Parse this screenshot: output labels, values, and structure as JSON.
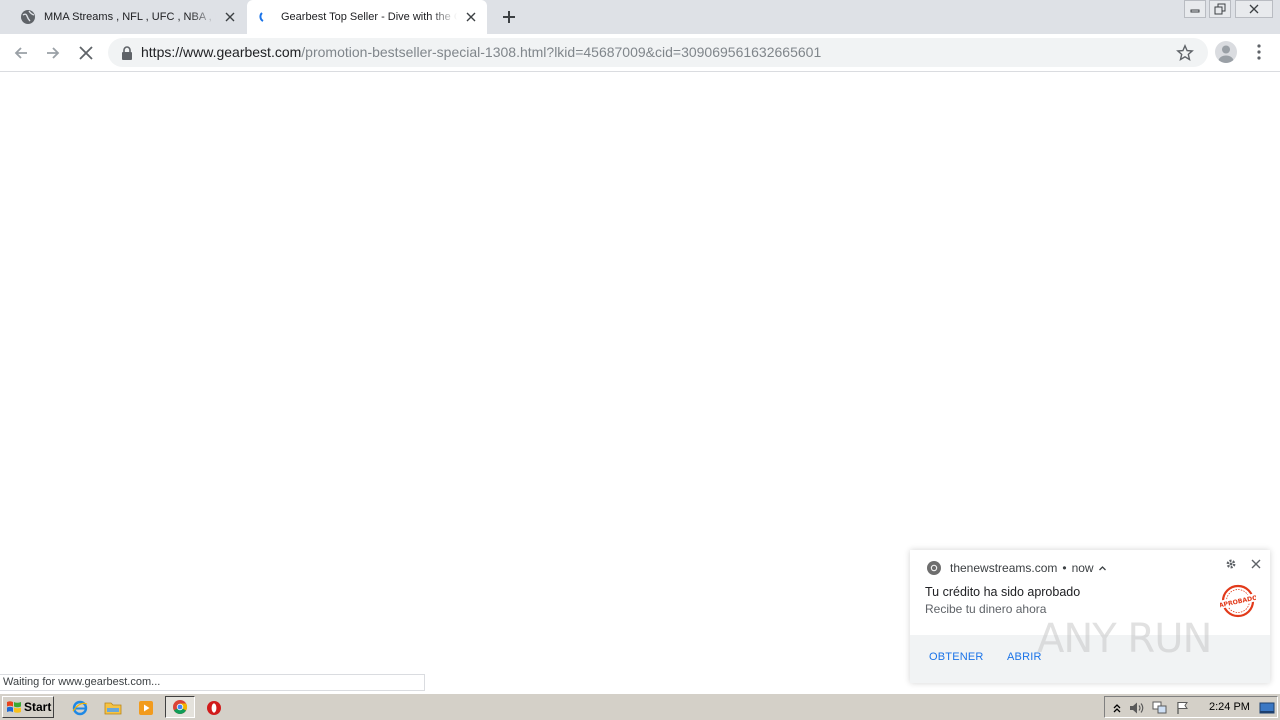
{
  "browser": {
    "tabs": [
      {
        "title": "MMA Streams , NFL , UFC , NBA , Bo",
        "icon": "globe-icon",
        "active": false
      },
      {
        "title": "Gearbest Top Seller - Dive with the Cr",
        "icon": "loading-spinner-icon",
        "active": true
      }
    ],
    "address": {
      "host": "https://www.gearbest.com",
      "path": "/promotion-bestseller-special-1308.html?lkid=45687009&cid=309069561632665601"
    },
    "status_text": "Waiting for www.gearbest.com..."
  },
  "notification": {
    "source": "thenewstreams.com",
    "separator": "•",
    "time": "now",
    "title": "Tu crédito ha sido aprobado",
    "body": "Recibe tu dinero ahora",
    "image_text": "APROBADO",
    "actions": [
      {
        "label": "OBTENER"
      },
      {
        "label": "ABRIR"
      }
    ]
  },
  "watermark": {
    "text": "ANY RUN"
  },
  "taskbar": {
    "start_label": "Start",
    "clock": "2:24 PM",
    "quicklaunch": [
      "internet-explorer-icon",
      "file-explorer-icon",
      "media-player-icon",
      "chrome-icon",
      "opera-icon"
    ]
  },
  "colors": {
    "tabstrip": "#dee1e6",
    "omnibox": "#f1f3f4",
    "link_blue": "#1a73e8",
    "taskbar": "#d4d0c8"
  }
}
